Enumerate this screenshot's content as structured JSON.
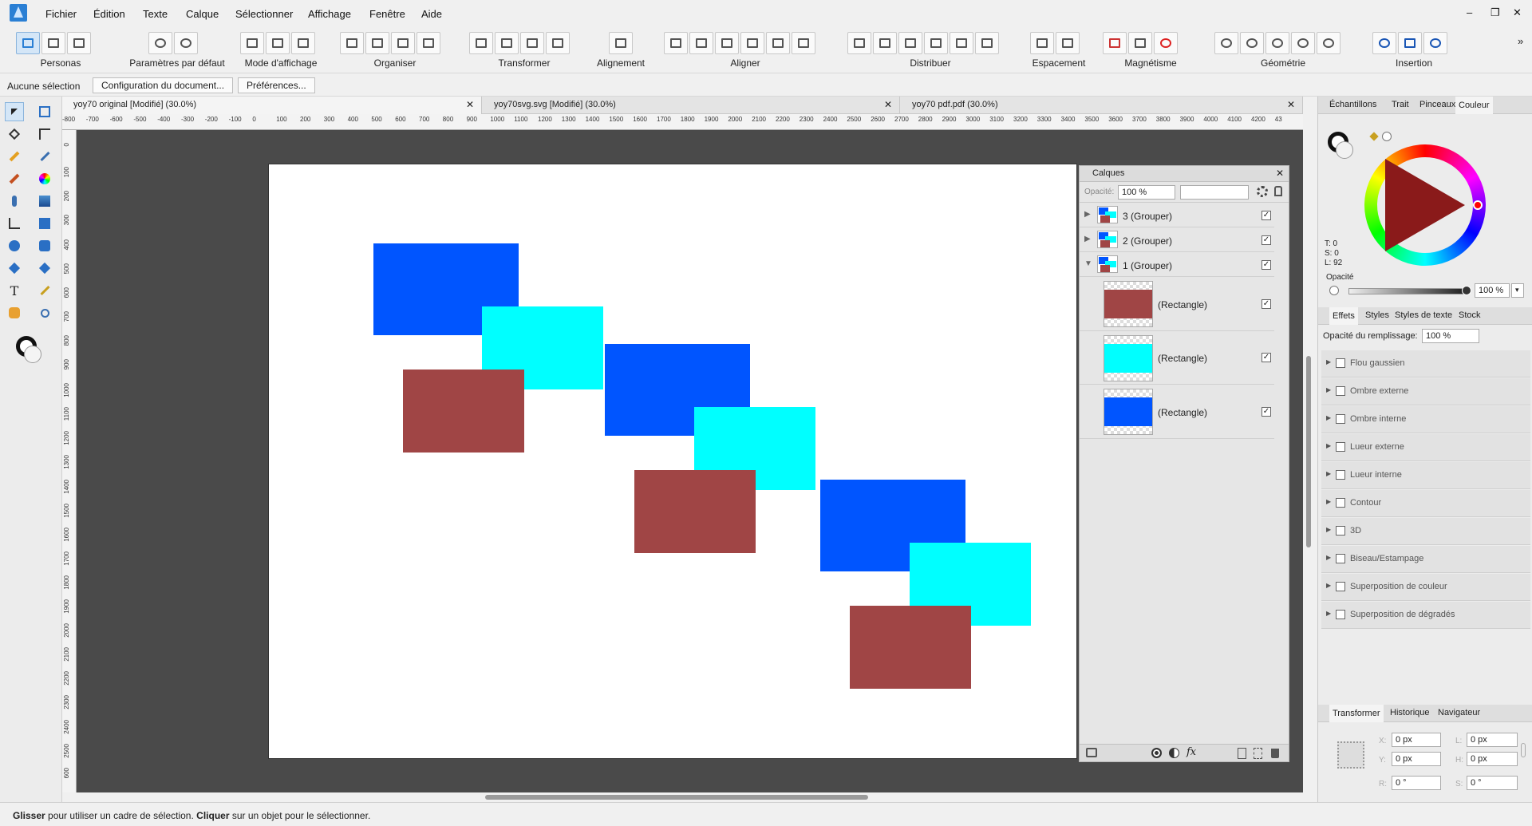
{
  "menu": [
    "Fichier",
    "Édition",
    "Texte",
    "Calque",
    "Sélectionner",
    "Affichage",
    "Fenêtre",
    "Aide"
  ],
  "window_controls": {
    "minimize": "–",
    "restore": "❐",
    "close": "✕"
  },
  "toolbar": {
    "personas_label": "Personas",
    "groups": [
      {
        "label": "Paramètres par défaut"
      },
      {
        "label": "Mode d'affichage"
      },
      {
        "label": "Organiser"
      },
      {
        "label": "Transformer"
      },
      {
        "label": "Alignement"
      },
      {
        "label": "Aligner"
      },
      {
        "label": "Distribuer"
      },
      {
        "label": "Espacement"
      },
      {
        "label": "Magnétisme"
      },
      {
        "label": "Géométrie"
      },
      {
        "label": "Insertion"
      }
    ],
    "overflow": "»"
  },
  "context": {
    "selection": "Aucune sélection",
    "doc_setup": "Configuration du document...",
    "prefs": "Préférences..."
  },
  "tabs": [
    {
      "label": "yoy70 original [Modifié] (30.0%)",
      "close": "✕"
    },
    {
      "label": "yoy70svg.svg [Modifié] (30.0%)",
      "close": "✕"
    },
    {
      "label": "yoy70 pdf.pdf (30.0%)",
      "close": "✕"
    }
  ],
  "ruler_h": [
    "-800",
    "-700",
    "-600",
    "-500",
    "-400",
    "-300",
    "-200",
    "-100",
    "0",
    "100",
    "200",
    "300",
    "400",
    "500",
    "600",
    "700",
    "800",
    "900",
    "1000",
    "1100",
    "1200",
    "1300",
    "1400",
    "1500",
    "1600",
    "1700",
    "1800",
    "1900",
    "2000",
    "2100",
    "2200",
    "2300",
    "2400",
    "2500",
    "2600",
    "2700",
    "2800",
    "2900",
    "3000",
    "3100",
    "3200",
    "3300",
    "3400",
    "3500",
    "3600",
    "3700",
    "3800",
    "3900",
    "4000",
    "4100",
    "4200",
    "43"
  ],
  "ruler_v": [
    "100",
    "0",
    "100",
    "200",
    "300",
    "400",
    "500",
    "600",
    "700",
    "800",
    "900",
    "1000",
    "1100",
    "1200",
    "1300",
    "1400",
    "1500",
    "1600",
    "1700",
    "1800",
    "1900",
    "2000",
    "2100",
    "2200",
    "2300",
    "2400",
    "2500",
    "600"
  ],
  "colors": {
    "blue": "#0055ff",
    "cyan": "#00ffff",
    "brown": "#a04545"
  },
  "layers": {
    "title": "Calques",
    "opacity_label": "Opacité:",
    "opacity_value": "100 %",
    "rows": [
      {
        "name": "3 (Grouper)",
        "checked": "✓"
      },
      {
        "name": "2 (Grouper)",
        "checked": "✓"
      },
      {
        "name": "1 (Grouper)",
        "checked": "✓"
      },
      {
        "name": "(Rectangle)",
        "checked": "✓"
      },
      {
        "name": "(Rectangle)",
        "checked": "✓"
      },
      {
        "name": "(Rectangle)",
        "checked": "✓"
      }
    ],
    "fx": "fx"
  },
  "color_panel": {
    "tabs": [
      "Échantillons",
      "Trait",
      "Pinceaux",
      "Couleur"
    ],
    "t": "T: 0",
    "s": "S: 0",
    "l": "L: 92",
    "opacity_label": "Opacité",
    "opacity_value": "100 %"
  },
  "effects_panel": {
    "tabs": [
      "Effets",
      "Styles",
      "Styles de texte",
      "Stock"
    ],
    "fill_opacity_label": "Opacité du remplissage:",
    "fill_opacity_value": "100 %",
    "effects": [
      "Flou gaussien",
      "Ombre externe",
      "Ombre interne",
      "Lueur externe",
      "Lueur interne",
      "Contour",
      "3D",
      "Biseau/Estampage",
      "Superposition de couleur",
      "Superposition de dégradés"
    ]
  },
  "transform_panel": {
    "tabs": [
      "Transformer",
      "Historique",
      "Navigateur"
    ],
    "x_label": "X:",
    "x": "0 px",
    "y_label": "Y:",
    "y": "0 px",
    "w_label": "L:",
    "w": "0 px",
    "h_label": "H:",
    "h": "0 px",
    "r_label": "R:",
    "r": "0 °",
    "s_label": "S:",
    "s": "0 °"
  },
  "status": {
    "b1": "Glisser",
    "t1": " pour utiliser un cadre de sélection. ",
    "b2": "Cliquer",
    "t2": " sur un objet pour le sélectionner."
  }
}
